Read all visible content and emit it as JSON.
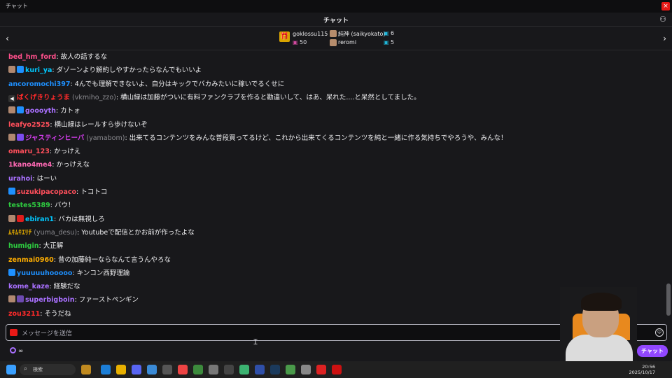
{
  "window": {
    "title": "チャット",
    "close": "×"
  },
  "header": {
    "title": "チャット",
    "users_glyph": "⚇"
  },
  "leaderboard": {
    "top_gift": {
      "name": "goklossu115",
      "count": "50"
    },
    "second": {
      "name": "純神 (saikyokato)",
      "count": "6"
    },
    "third": {
      "name": "reromi",
      "count": "5"
    },
    "prev": "‹",
    "next": "›"
  },
  "messages": [
    {
      "name": "bed_hm_ford",
      "color": "#ff4f8b",
      "text": "故人の話するな",
      "badges": []
    },
    {
      "name": "kuri_ya",
      "color": "#00c8ff",
      "text": "ダゾーンより解約しやすかったらなんでもいいよ",
      "badges": [
        "avatar",
        "prime"
      ]
    },
    {
      "name": "ancoromochi397",
      "color": "#1e90ff",
      "text": "4んでも理解できないよ、自分はキックでバカみたいに稼いでるくせに",
      "badges": []
    },
    {
      "name": "ばくげきりょうま",
      "display": "(vkmiho_zzo)",
      "color": "#ff2a2a",
      "text": "横山緑は加藤がついに有料ファンクラブを作ると勘違いして、はあ、呆れた....と呆然としてました。",
      "badges": [
        "mute"
      ]
    },
    {
      "name": "goooyth",
      "color": "#a970ff",
      "text": "カトォ",
      "badges": [
        "avatar",
        "prime"
      ]
    },
    {
      "name": "leafyo2525",
      "color": "#ff4f5b",
      "text": "横山緑はレールすら歩けないぞ",
      "badges": []
    },
    {
      "name": "ジャスティンヒーバ",
      "display": "(yamabom)",
      "color": "#d93df2",
      "text": "出来てるコンテンツをみんな普段買ってるけど、これから出来てくるコンテンツを純と一緒に作る気持ちでやろうや、みんな！",
      "badges": [
        "avatar",
        "sub"
      ]
    },
    {
      "name": "omaru_123",
      "color": "#ff4f5b",
      "text": "かっけえ",
      "badges": []
    },
    {
      "name": "1kano4me4",
      "color": "#ff69b4",
      "text": "かっけえな",
      "badges": []
    },
    {
      "name": "urahoi",
      "color": "#a970ff",
      "text": "はーい",
      "badges": []
    },
    {
      "name": "suzukipacopaco",
      "color": "#ff4f5b",
      "text": "トコトコ",
      "badges": [
        "prime"
      ]
    },
    {
      "name": "testes5389",
      "color": "#2ecc40",
      "text": "バウ！",
      "badges": []
    },
    {
      "name": "ebiran1",
      "color": "#00c8ff",
      "text": "バカは無視しろ",
      "badges": [
        "avatar",
        "red"
      ]
    },
    {
      "name": "ﾑｷﾑｷｴﾘﾁ",
      "display": "(yuma_desu)",
      "color": "#d9a400",
      "text": "Youtubeで配信とかお前が作ったよな",
      "badges": []
    },
    {
      "name": "humigin",
      "color": "#2ecc40",
      "text": "大正解",
      "badges": []
    },
    {
      "name": "zenmai0960",
      "color": "#ffae00",
      "text": "昔の加藤純一ならなんて言うんやろな",
      "badges": []
    },
    {
      "name": "yuuuuuhooooo",
      "color": "#1e90ff",
      "text": "キンコン西野理論",
      "badges": [
        "prime"
      ]
    },
    {
      "name": "kome_kaze",
      "color": "#a970ff",
      "text": "経験だな",
      "badges": []
    },
    {
      "name": "superbigboin",
      "color": "#a970ff",
      "text": "ファーストペンギン",
      "badges": [
        "avatar",
        "gift"
      ]
    },
    {
      "name": "zou3211",
      "color": "#ff2a2a",
      "text": "そうだね",
      "badges": []
    }
  ],
  "input": {
    "placeholder": "メッセージを送信"
  },
  "points": {
    "value": "∞"
  },
  "chat_button": {
    "label": "チャット"
  },
  "taskbar": {
    "search_label": "検索",
    "time": "20:56",
    "date": "2025/10/17"
  }
}
